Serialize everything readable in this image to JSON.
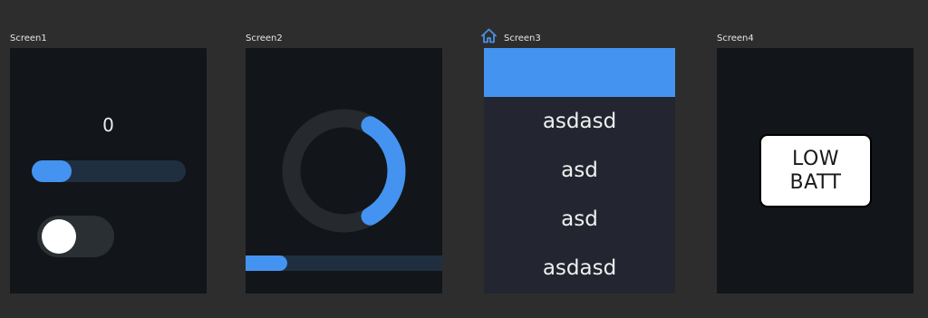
{
  "colors": {
    "background": "#2d2d2d",
    "screen_bg": "#121519",
    "accent": "#4493f0",
    "track": "#1f2f40",
    "label_text": "#e6e6e6"
  },
  "screens": [
    {
      "label": "Screen1"
    },
    {
      "label": "Screen2"
    },
    {
      "label": "Screen3",
      "icon": "home-icon"
    },
    {
      "label": "Screen4"
    }
  ],
  "screen1": {
    "value_text": "0",
    "slider_fraction": 0.26,
    "switch_on": false
  },
  "screen2": {
    "arc_start_deg": 30,
    "arc_end_deg": 150,
    "bar_fraction": 0.21
  },
  "screen3": {
    "items": [
      "asdasd",
      "asd",
      "asd",
      "asdasd"
    ]
  },
  "screen4": {
    "line1": "LOW",
    "line2": "BATT"
  }
}
